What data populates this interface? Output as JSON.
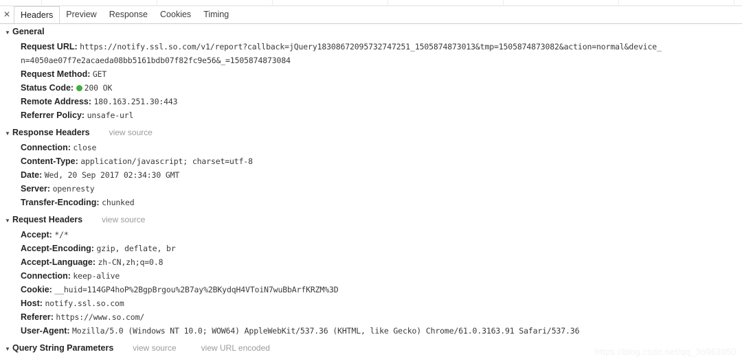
{
  "tabbar": {
    "close_icon": "close-icon",
    "close_glyph": "✕",
    "tabs": [
      {
        "label": "Headers",
        "active": true
      },
      {
        "label": "Preview",
        "active": false
      },
      {
        "label": "Response",
        "active": false
      },
      {
        "label": "Cookies",
        "active": false
      },
      {
        "label": "Timing",
        "active": false
      }
    ]
  },
  "triangle_glyph": "▼",
  "sections": [
    {
      "id": "general",
      "title": "General",
      "links": [],
      "rows": [
        {
          "key": "Request URL:",
          "value": "https://notify.ssl.so.com/v1/report?callback=jQuery18308672095732747251_1505874873013&tmp=1505874873082&action=normal&device_",
          "continuation": "n=4050ae07f7e2acaeda08bb5161bdb07f82fc9e56&_=1505874873084"
        },
        {
          "key": "Request Method:",
          "value": "GET"
        },
        {
          "key": "Status Code:",
          "value": "200 OK",
          "status_dot": "#3fae3f"
        },
        {
          "key": "Remote Address:",
          "value": "180.163.251.30:443"
        },
        {
          "key": "Referrer Policy:",
          "value": "unsafe-url"
        }
      ]
    },
    {
      "id": "response-headers",
      "title": "Response Headers",
      "links": [
        "view source"
      ],
      "rows": [
        {
          "key": "Connection:",
          "value": "close"
        },
        {
          "key": "Content-Type:",
          "value": "application/javascript; charset=utf-8"
        },
        {
          "key": "Date:",
          "value": "Wed, 20 Sep 2017 02:34:30 GMT"
        },
        {
          "key": "Server:",
          "value": "openresty"
        },
        {
          "key": "Transfer-Encoding:",
          "value": "chunked"
        }
      ]
    },
    {
      "id": "request-headers",
      "title": "Request Headers",
      "links": [
        "view source"
      ],
      "rows": [
        {
          "key": "Accept:",
          "value": "*/*"
        },
        {
          "key": "Accept-Encoding:",
          "value": "gzip, deflate, br"
        },
        {
          "key": "Accept-Language:",
          "value": "zh-CN,zh;q=0.8"
        },
        {
          "key": "Connection:",
          "value": "keep-alive"
        },
        {
          "key": "Cookie:",
          "value": "__huid=114GP4hoP%2BgpBrgou%2B7ay%2BKydqH4VToiN7wuBbArfKRZM%3D"
        },
        {
          "key": "Host:",
          "value": "notify.ssl.so.com"
        },
        {
          "key": "Referer:",
          "value": "https://www.so.com/"
        },
        {
          "key": "User-Agent:",
          "value": "Mozilla/5.0 (Windows NT 10.0; WOW64) AppleWebKit/537.36 (KHTML, like Gecko) Chrome/61.0.3163.91 Safari/537.36"
        }
      ]
    },
    {
      "id": "query-string-parameters",
      "title": "Query String Parameters",
      "links": [
        "view source",
        "view URL encoded"
      ],
      "rows": []
    }
  ],
  "watermark": "https://blog.csdn.net/qq_36963950"
}
